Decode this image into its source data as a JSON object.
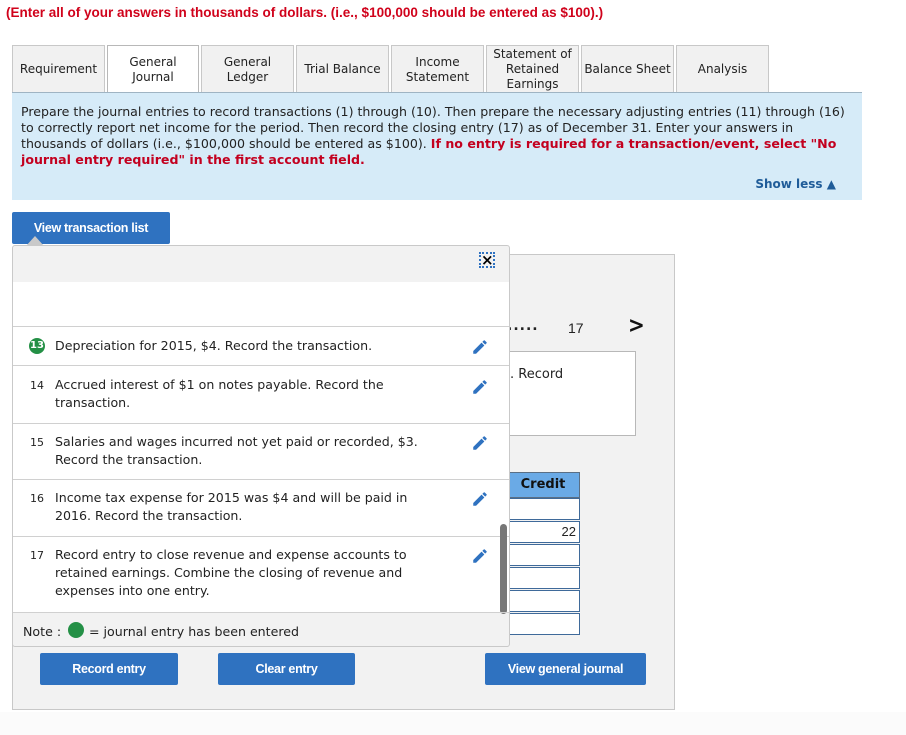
{
  "instruction": "(Enter all of your answers in thousands of dollars. (i.e., $100,000 should be entered as $100).)",
  "tabs": [
    {
      "label": "Requirement",
      "active": false
    },
    {
      "label": "General Journal",
      "active": true
    },
    {
      "label": "General Ledger",
      "active": false
    },
    {
      "label": "Trial Balance",
      "active": false
    },
    {
      "label": "Income Statement",
      "active": false
    },
    {
      "label": "Statement of Retained Earnings",
      "active": false
    },
    {
      "label": "Balance Sheet",
      "active": false
    },
    {
      "label": "Analysis",
      "active": false
    }
  ],
  "panel": {
    "text_normal": "Prepare the journal entries to record transactions (1) through (10).  Then prepare the necessary adjusting entries (11) through (16) to correctly report net income for the period.  Then record the closing entry (17) as of December 31. Enter your answers in thousands of dollars (i.e., $100,000 should be entered as $100). ",
    "text_bold_red": "If no entry is required for a transaction/event, select \"No journal entry required\" in the first account field.",
    "show_less": "Show less"
  },
  "view_transaction_list_label": "View transaction list",
  "transactions": [
    {
      "number": "13",
      "text": "Depreciation for 2015, $4. Record the transaction.",
      "entered": true
    },
    {
      "number": "14",
      "text": "Accrued interest of $1 on notes payable. Record the transaction.",
      "entered": false
    },
    {
      "number": "15",
      "text": "Salaries and wages incurred not yet paid or recorded, $3. Record the transaction.",
      "entered": false
    },
    {
      "number": "16",
      "text": "Income tax expense for 2015 was $4 and will be paid in 2016. Record the transaction.",
      "entered": false
    },
    {
      "number": "17",
      "text": "Record entry to close revenue and expense accounts to retained earnings. Combine the closing of revenue and expenses into one entry.",
      "entered": false
    }
  ],
  "note": {
    "label": "Note :",
    "text": "= journal entry has been entered"
  },
  "journal": {
    "pager_dots": ".....",
    "pager_current": "17",
    "description_partial": ". Record",
    "credit_header": "Credit",
    "credit_values": [
      "",
      "22",
      "",
      "",
      "",
      ""
    ]
  },
  "buttons": {
    "record_entry": "Record entry",
    "clear_entry": "Clear entry",
    "view_general_journal": "View general journal"
  },
  "colors": {
    "accent": "#2f72c0",
    "warning_red": "#d0021b",
    "entered_green": "#249046",
    "panel_blue": "#d6ebf8"
  }
}
